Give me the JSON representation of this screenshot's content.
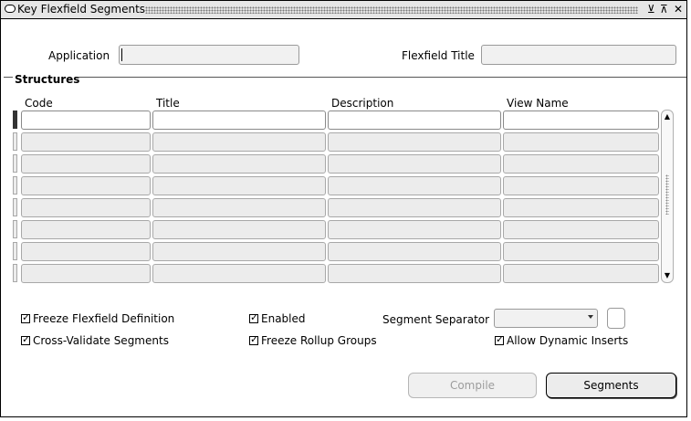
{
  "window": {
    "title": "Key Flexfield Segments",
    "controls": {
      "minimize": "⊻",
      "maximize": "⊼",
      "close": "✕"
    }
  },
  "header": {
    "application_label": "Application",
    "application_value": "",
    "flexfield_title_label": "Flexfield Title",
    "flexfield_title_value": ""
  },
  "structures": {
    "label": "Structures",
    "columns": [
      "Code",
      "Title",
      "Description",
      "View Name"
    ],
    "row_count": 8,
    "rows": [
      [
        "",
        "",
        "",
        ""
      ],
      [
        "",
        "",
        "",
        ""
      ],
      [
        "",
        "",
        "",
        ""
      ],
      [
        "",
        "",
        "",
        ""
      ],
      [
        "",
        "",
        "",
        ""
      ],
      [
        "",
        "",
        "",
        ""
      ],
      [
        "",
        "",
        "",
        ""
      ],
      [
        "",
        "",
        "",
        ""
      ]
    ]
  },
  "options": {
    "freeze_flexfield_definition": {
      "label": "Freeze Flexfield Definition",
      "checked": true
    },
    "cross_validate_segments": {
      "label": "Cross-Validate Segments",
      "checked": true
    },
    "enabled": {
      "label": "Enabled",
      "checked": true
    },
    "freeze_rollup_groups": {
      "label": "Freeze Rollup Groups",
      "checked": true
    },
    "segment_separator_label": "Segment Separator",
    "segment_separator_value": "",
    "allow_dynamic_inserts": {
      "label": "Allow Dynamic Inserts",
      "checked": true
    }
  },
  "buttons": {
    "compile": "Compile",
    "segments": "Segments"
  },
  "colors": {
    "disabled_text": "#9c9c9c",
    "field_bg": "#ececec",
    "active_indicator": "#333333"
  }
}
